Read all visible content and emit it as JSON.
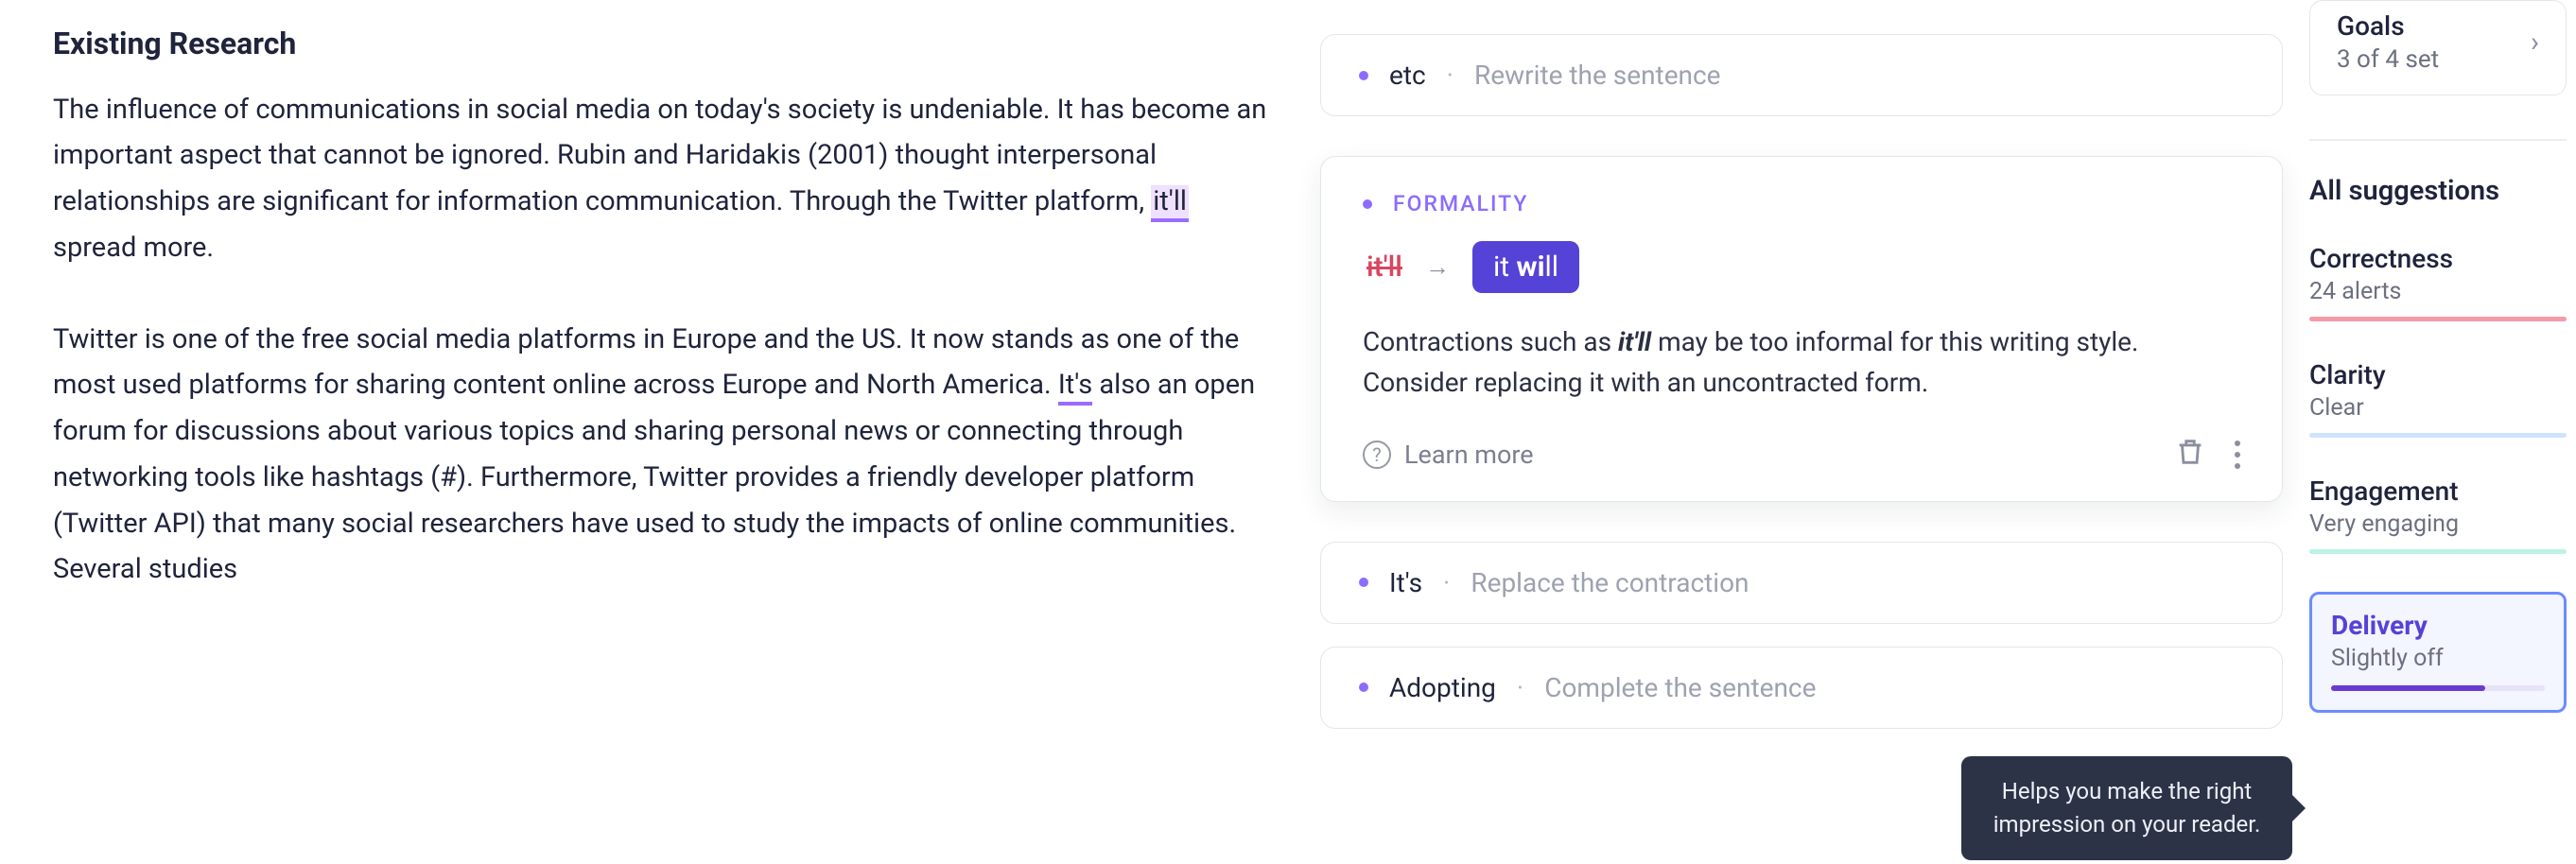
{
  "document": {
    "heading": "Existing Research",
    "p1_a": "The influence of communications in social media on today's society is undeniable. It has become an important aspect that cannot be ignored. Rubin and Haridakis (2001) thought interpersonal relationships are significant for information communication. Through the Twitter platform, ",
    "p1_hl": "it'll",
    "p1_b": " spread more.",
    "p2_a": "Twitter is one of the free social media platforms in Europe and the US. It now stands as one of the most used platforms for sharing content online across Europe and North America. ",
    "p2_hl": "It's",
    "p2_b": " also an open forum for discussions about various topics and sharing personal news or connecting through networking tools like hashtags (#). Furthermore, Twitter provides a friendly developer platform (Twitter API) that many social researchers have used to study the impacts of online communities. Several studies"
  },
  "cards": {
    "etc": {
      "word": "etc",
      "sep": "·",
      "hint": "Rewrite the sentence"
    },
    "its": {
      "word": "It's",
      "sep": "·",
      "hint": "Replace the contraction"
    },
    "adopting": {
      "word": "Adopting",
      "sep": "·",
      "hint": "Complete the sentence"
    }
  },
  "detail": {
    "category": "FORMALITY",
    "from": "it'll",
    "to_pre": "it ",
    "to_bold": "wi",
    "to_post": "ll",
    "explain_a": "Contractions such as ",
    "explain_em": "it'll",
    "explain_b": " may be too informal for this writing style. Consider replacing it with an uncontracted form.",
    "learn": "Learn more"
  },
  "sidebar": {
    "goals_title": "Goals",
    "goals_sub": "3 of 4 set",
    "all": "All suggestions",
    "metrics": {
      "correctness": {
        "title": "Correctness",
        "sub": "24 alerts"
      },
      "clarity": {
        "title": "Clarity",
        "sub": "Clear"
      },
      "engagement": {
        "title": "Engagement",
        "sub": "Very engaging"
      },
      "delivery": {
        "title": "Delivery",
        "sub": "Slightly off"
      }
    }
  },
  "tooltip": "Helps you make the right impression on your reader."
}
